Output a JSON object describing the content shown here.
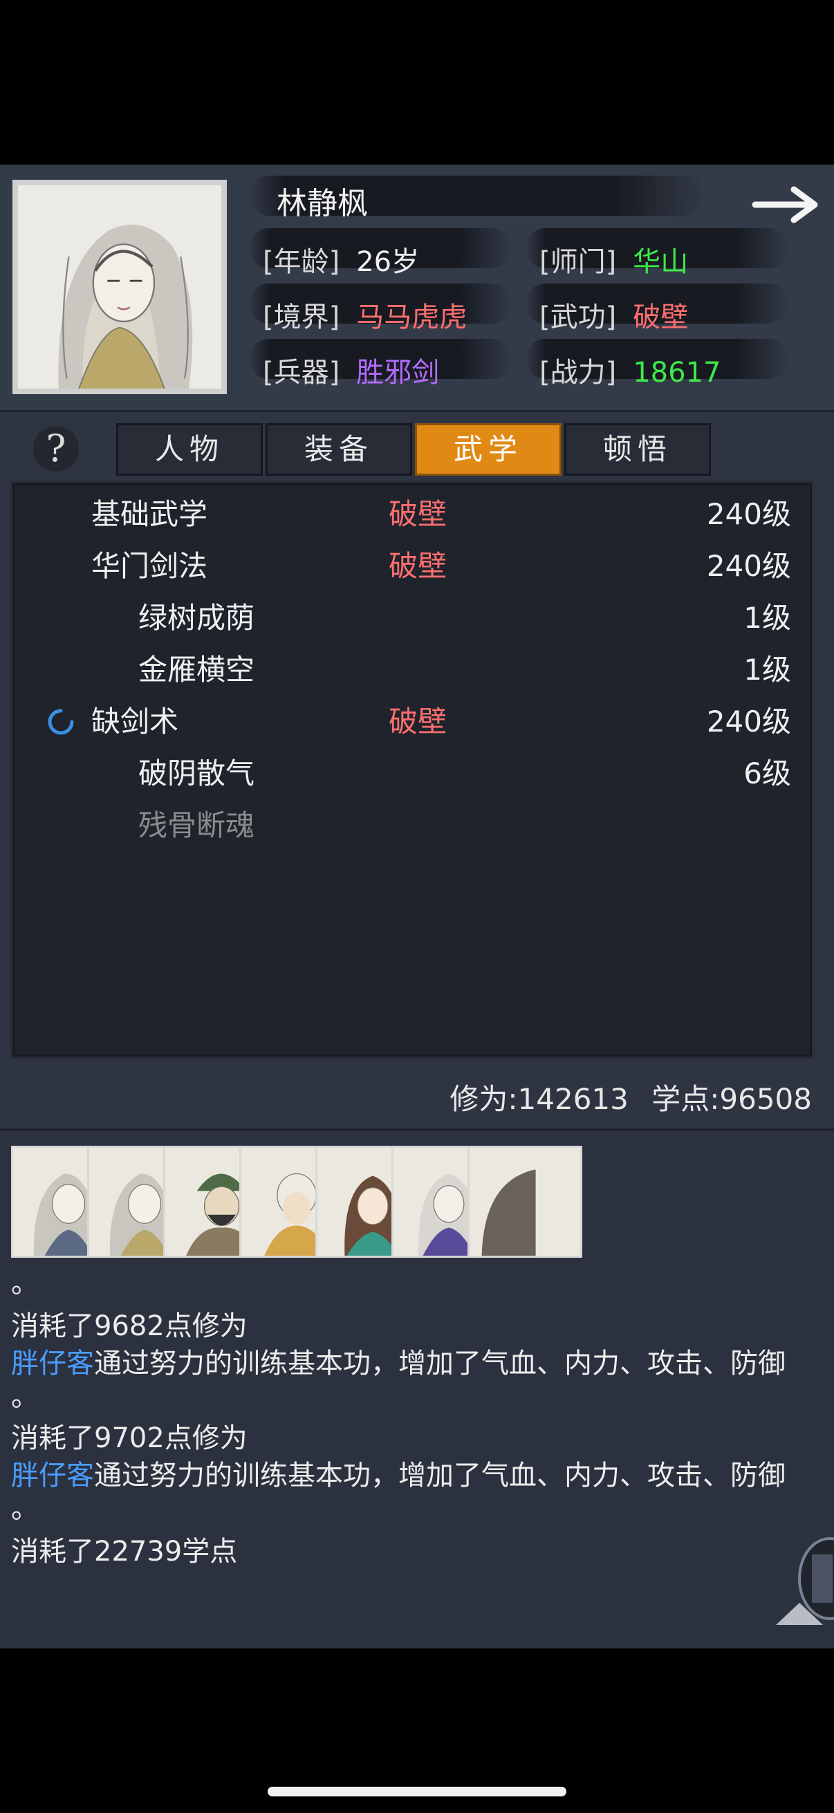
{
  "hero": {
    "name": "林静枫",
    "age_label": "[年龄]",
    "age_value": "26岁",
    "school_label": "[师门]",
    "school_value": "华山",
    "realm_label": "[境界]",
    "realm_value": "马马虎虎",
    "martial_label": "[武功]",
    "martial_value": "破壁",
    "weapon_label": "[兵器]",
    "weapon_value": "胜邪剑",
    "power_label": "[战力]",
    "power_value": "18617"
  },
  "help_label": "?",
  "tabs": [
    {
      "label": "人物",
      "active": false
    },
    {
      "label": "装备",
      "active": false
    },
    {
      "label": "武学",
      "active": true
    },
    {
      "label": "顿悟",
      "active": false
    }
  ],
  "skills": [
    {
      "name": "基础武学",
      "realm": "破壁",
      "level": "240级"
    },
    {
      "name": "华门剑法",
      "realm": "破壁",
      "level": "240级"
    },
    {
      "name": "绿树成荫",
      "realm": "",
      "level": "1级"
    },
    {
      "name": "金雁横空",
      "realm": "",
      "level": "1级"
    },
    {
      "name": "缺剑术",
      "realm": "破壁",
      "level": "240级",
      "training": true
    },
    {
      "name": "破阴散气",
      "realm": "",
      "level": "6级"
    },
    {
      "name": "残骨断魂",
      "realm": "",
      "level": "",
      "locked": true
    }
  ],
  "stats": {
    "cultivation_label": "修为:",
    "cultivation_value": "142613",
    "points_label": "学点:",
    "points_value": "96508"
  },
  "log": [
    {
      "text": "。"
    },
    {
      "text": "消耗了9682点修为"
    },
    {
      "who": "胖仔客",
      "text": "通过努力的训练基本功，增加了气血、内力、攻击、防御"
    },
    {
      "text": "。"
    },
    {
      "text": "消耗了9702点修为"
    },
    {
      "who": "胖仔客",
      "text": "通过努力的训练基本功，增加了气血、内力、攻击、防御"
    },
    {
      "text": "。"
    },
    {
      "text": "消耗了22739学点"
    }
  ],
  "colors": {
    "accent_tab": "#e08a15",
    "realm_red": "#ff6f6f",
    "power_green": "#3ee84a",
    "weapon_purple": "#b46bff",
    "name_blue": "#4a9cff"
  },
  "icons": {
    "next": "arrow-right-icon",
    "training": "loading-spinner-icon",
    "scroll": "triangle-up-icon"
  }
}
